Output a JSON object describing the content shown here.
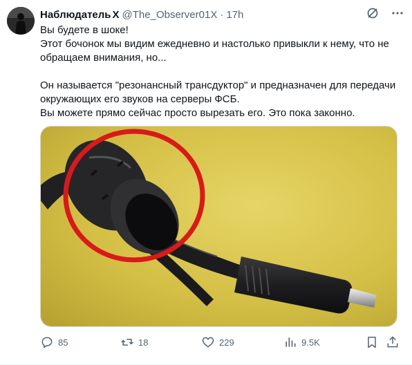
{
  "tweet": {
    "author_name": "Наблюдатель",
    "badge": "X",
    "handle": "@The_Observer01X",
    "separator": "·",
    "time": "17h",
    "lines": [
      "Вы будете в шоке!",
      "Этот бочонок мы видим ежедневно и настолько привыкли к нему, что не",
      "обращаем внимания, но...",
      "",
      "Он называется \"резонансный трансдуктор\" и предназначен для передачи",
      "окружающих его звуков на серверы ФСБ.",
      "Вы можете прямо сейчас просто вырезать его. Это пока законно."
    ]
  },
  "actions": {
    "replies": "85",
    "reposts": "18",
    "likes": "229",
    "views": "9.5K"
  },
  "colors": {
    "text": "#0f1419",
    "muted": "#536471",
    "border": "#cfd9de",
    "photo_background": "#d8c24a",
    "highlight_circle": "#d81a1a"
  },
  "icons": [
    "grok-icon",
    "more-icon",
    "reply-icon",
    "repost-icon",
    "like-icon",
    "views-icon",
    "bookmark-icon",
    "share-icon"
  ]
}
